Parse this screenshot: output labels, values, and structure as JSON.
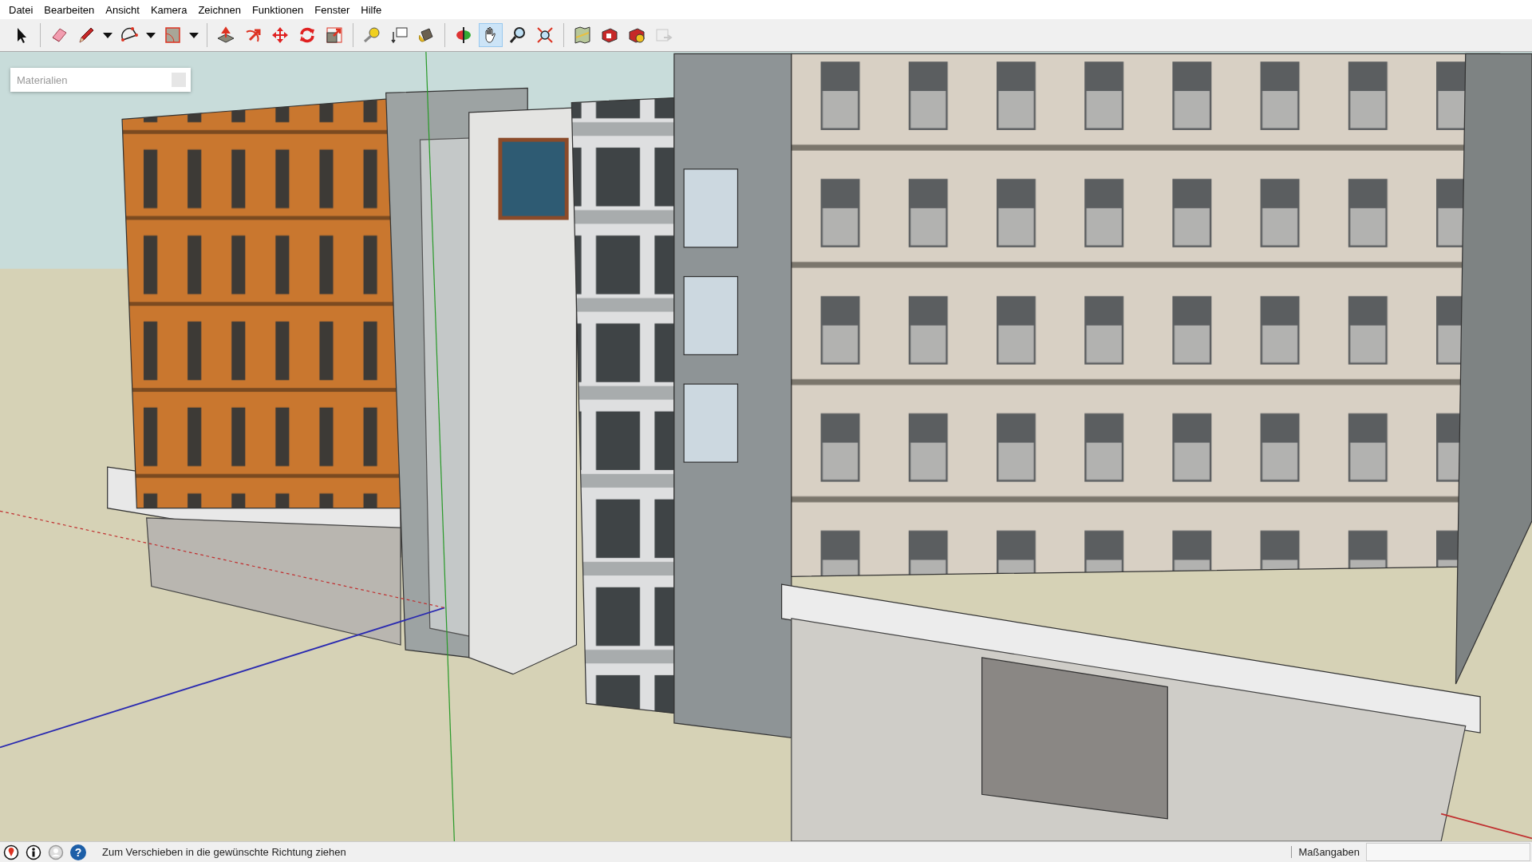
{
  "menu": [
    "Datei",
    "Bearbeiten",
    "Ansicht",
    "Kamera",
    "Zeichnen",
    "Funktionen",
    "Fenster",
    "Hilfe"
  ],
  "toolbar": [
    {
      "kind": "select",
      "selected": false
    },
    {
      "kind": "separator"
    },
    {
      "kind": "eraser",
      "selected": false
    },
    {
      "kind": "pencil",
      "selected": false
    },
    {
      "kind": "caret"
    },
    {
      "kind": "arc",
      "selected": false
    },
    {
      "kind": "caret"
    },
    {
      "kind": "rectangle",
      "selected": false
    },
    {
      "kind": "caret"
    },
    {
      "kind": "separator"
    },
    {
      "kind": "pushpull",
      "selected": false
    },
    {
      "kind": "offset",
      "selected": false
    },
    {
      "kind": "move",
      "selected": false
    },
    {
      "kind": "rotate",
      "selected": false
    },
    {
      "kind": "scale",
      "selected": false
    },
    {
      "kind": "separator"
    },
    {
      "kind": "tape",
      "selected": false
    },
    {
      "kind": "text",
      "selected": false
    },
    {
      "kind": "paint",
      "selected": false
    },
    {
      "kind": "separator"
    },
    {
      "kind": "orbit",
      "selected": false
    },
    {
      "kind": "pan",
      "selected": true
    },
    {
      "kind": "zoom",
      "selected": false
    },
    {
      "kind": "extents",
      "selected": false
    },
    {
      "kind": "separator"
    },
    {
      "kind": "map",
      "selected": false
    },
    {
      "kind": "warehouse",
      "selected": false
    },
    {
      "kind": "extension",
      "selected": false
    },
    {
      "kind": "share",
      "selected": false,
      "disabled": true
    }
  ],
  "materials_panel": {
    "placeholder": "Materialien"
  },
  "status_bar": {
    "help_glyph": "?",
    "hint": "Zum Verschieben in die gewünschte Richtung ziehen",
    "measurements_label": "Maßangaben"
  }
}
